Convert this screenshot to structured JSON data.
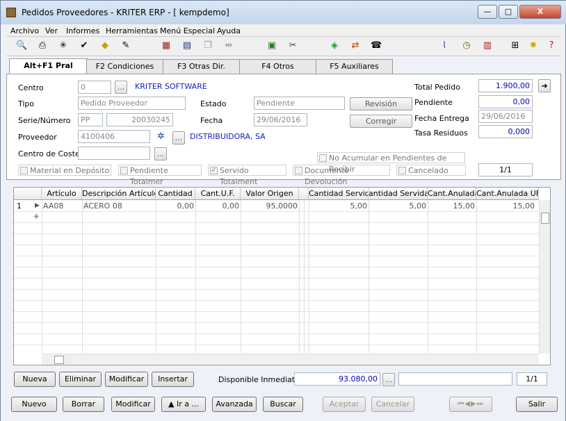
{
  "window": {
    "title": "Pedidos Proveedores - KRITER ERP - [ kempdemo]",
    "min": "—",
    "max": "□",
    "close": "X"
  },
  "menu": [
    "Archivo",
    "Ver",
    "Informes",
    "Herramientas",
    "Menú Especial",
    "Ayuda"
  ],
  "toolbar_icons": [
    "preview-icon",
    "print-icon",
    "sparkle-icon",
    "check-icon",
    "warning-icon",
    "erase-icon",
    "chart-icon",
    "calculator-icon",
    "copy-icon",
    "link-icon",
    "paste-icon",
    "scissors-icon",
    "note-icon",
    "arrows-icon",
    "phone-icon",
    "clip-icon",
    "clock-icon",
    "doc-icon",
    "tree-icon",
    "bulb-icon",
    "help-icon"
  ],
  "tabs": [
    "Alt+F1 Pral",
    "F2 Condiciones",
    "F3 Otras Dir.",
    "F4 Otros",
    "F5 Auxiliares"
  ],
  "form": {
    "centro_label": "Centro",
    "centro_value": "0",
    "centro_btn": "...",
    "centro_name": "KRITER SOFTWARE",
    "tipo_label": "Tipo",
    "tipo_value": "Pedido Proveedor",
    "estado_label": "Estado",
    "estado_value": "Pendiente",
    "serie_label": "Serie/Número",
    "serie_value": "PP",
    "numero_value": "20030245",
    "fecha_label": "Fecha",
    "fecha_value": "29/06/2016",
    "proveedor_label": "Proveedor",
    "proveedor_value": "4100406",
    "proveedor_btn": "...",
    "proveedor_name": "DISTRIBUIDORA, SA",
    "coste_label": "Centro de Coste",
    "coste_btn": "...",
    "revision": "Revisión",
    "corregir": "Corregir",
    "total_label": "Total Pedido",
    "total_value": "1.900,00",
    "pendiente_label": "Pendiente",
    "pendiente_value": "0,00",
    "entrega_label": "Fecha Entrega",
    "entrega_value": "29/06/2016",
    "tasa_label": "Tasa Residuos",
    "tasa_value": "0,000",
    "no_acumular": "No Acumular en Pendientes de Recibir",
    "checks": [
      "Material en Depósito",
      "Pendiente Totalmer",
      "Servido Totalment",
      "Documento Devolución",
      "Cancelado"
    ],
    "page": "1/1"
  },
  "grid": {
    "headers": [
      "Artículo",
      "Descripción Artículo",
      "Cantidad",
      "Cant.U.F.",
      "Valor Origen",
      "",
      "Cantidad Servida",
      "antidad Servida U",
      "Cant.Anulada",
      "Cant.Anulada UF"
    ],
    "rows": [
      {
        "n": "1",
        "articulo": "AA08",
        "descripcion": "ACERO 08",
        "cantidad": "0,00",
        "cant_uf": "0,00",
        "valor": "95,0000",
        "servida": "5,00",
        "servida_u": "5,00",
        "anulada": "15,00",
        "anulada_uf": "15,00"
      }
    ]
  },
  "grid_buttons": {
    "nueva": "Nueva",
    "eliminar": "Eliminar",
    "modificar": "Modificar",
    "insertar": "Insertar"
  },
  "disponible": {
    "label": "Disponible Inmediato",
    "value": "93.080,00",
    "btn": "...",
    "page": "1/1"
  },
  "bottom": {
    "nuevo": "Nuevo",
    "borrar": "Borrar",
    "modificar": "Modificar",
    "ira": "▲ Ir a ...",
    "avanzada": "Avanzada",
    "buscar": "Buscar",
    "aceptar": "Aceptar",
    "cancelar": "Cancelar",
    "salir": "Salir"
  }
}
